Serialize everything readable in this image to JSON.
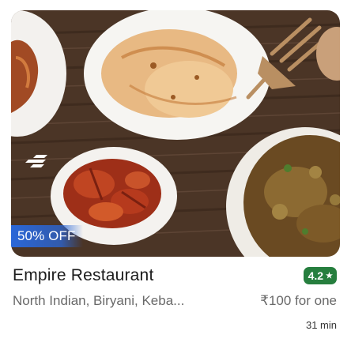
{
  "restaurant": {
    "name": "Empire Restaurant",
    "rating": "4.2",
    "rating_star": "★",
    "rating_color": "#267e3e",
    "cuisines": "North Indian, Biryani, Keba...",
    "price": "₹100 for one",
    "delivery_time": "31 min"
  },
  "offer": {
    "label": "50% OFF",
    "color": "#2a67d8"
  },
  "image": {
    "icon": "food-photo-icon"
  }
}
